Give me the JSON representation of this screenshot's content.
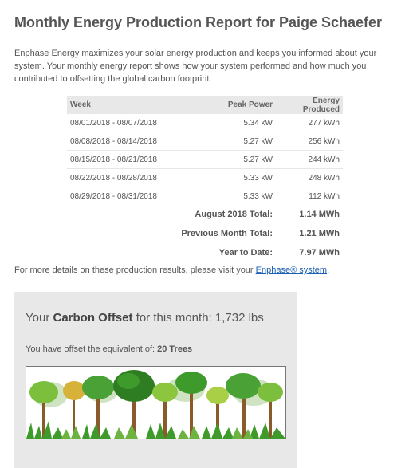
{
  "report": {
    "title": "Monthly Energy Production Report for Paige Schaefer",
    "intro": "Enphase Energy maximizes your solar energy production and keeps you informed about your system. Your monthly energy report shows how your system performed and how much you contributed to offsetting the global carbon footprint."
  },
  "table": {
    "headers": {
      "week": "Week",
      "peak": "Peak Power",
      "energy": "Energy Produced"
    },
    "rows": [
      {
        "week": "08/01/2018 - 08/07/2018",
        "peak": "5.34 kW",
        "energy": "277 kWh"
      },
      {
        "week": "08/08/2018 - 08/14/2018",
        "peak": "5.27 kW",
        "energy": "256 kWh"
      },
      {
        "week": "08/15/2018 - 08/21/2018",
        "peak": "5.27 kW",
        "energy": "244 kWh"
      },
      {
        "week": "08/22/2018 - 08/28/2018",
        "peak": "5.33 kW",
        "energy": "248 kWh"
      },
      {
        "week": "08/29/2018 - 08/31/2018",
        "peak": "5.33 kW",
        "energy": "112 kWh"
      }
    ],
    "totals": [
      {
        "label": "August 2018 Total:",
        "value": "1.14 MWh"
      },
      {
        "label": "Previous Month Total:",
        "value": "1.21 MWh"
      },
      {
        "label": "Year to Date:",
        "value": "7.97 MWh"
      }
    ]
  },
  "details": {
    "prefix": "For more details on these production results, please visit your ",
    "link": "Enphase® system",
    "suffix": "."
  },
  "carbon": {
    "prefix": "Your ",
    "bold": "Carbon Offset",
    "middle": " for this month: ",
    "value": "1,732 lbs",
    "offset_prefix": "You have offset the equivalent of: ",
    "offset_value": "20 Trees"
  },
  "colors": {
    "link": "#1a5fb4",
    "panel_bg": "#e8e8e8",
    "header_bg": "#e8e8e8",
    "tree_green": "#3f9a2c"
  }
}
